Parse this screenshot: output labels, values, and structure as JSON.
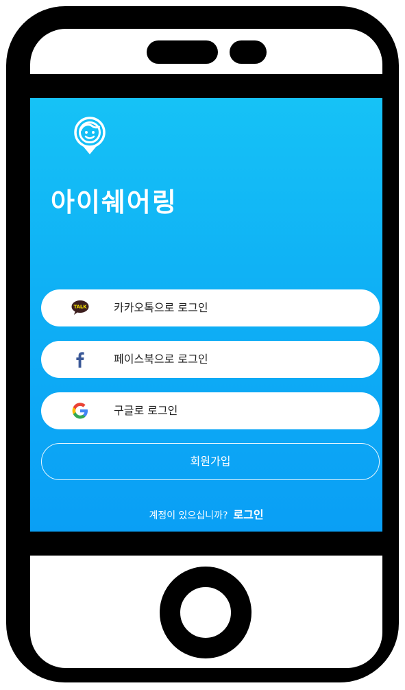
{
  "app": {
    "title": "아이쉐어링"
  },
  "login_buttons": {
    "kakao_label": "카카오톡으로 로그인",
    "kakao_icon_text": "TALK",
    "facebook_label": "페이스북으로 로그인",
    "google_label": "구글로 로그인"
  },
  "signup": {
    "label": "회원가입"
  },
  "footer": {
    "prompt": "계정이 있으십니까?",
    "login_link": "로그인"
  },
  "colors": {
    "screen_top": "#16c2f6",
    "screen_bottom": "#0a9ff5",
    "kakao_bubble": "#3c1e1e",
    "facebook_blue": "#3b5998"
  },
  "icons": [
    "phone-speaker",
    "home-button",
    "face-pin-logo-icon",
    "kakaotalk-icon",
    "facebook-icon",
    "google-icon"
  ]
}
